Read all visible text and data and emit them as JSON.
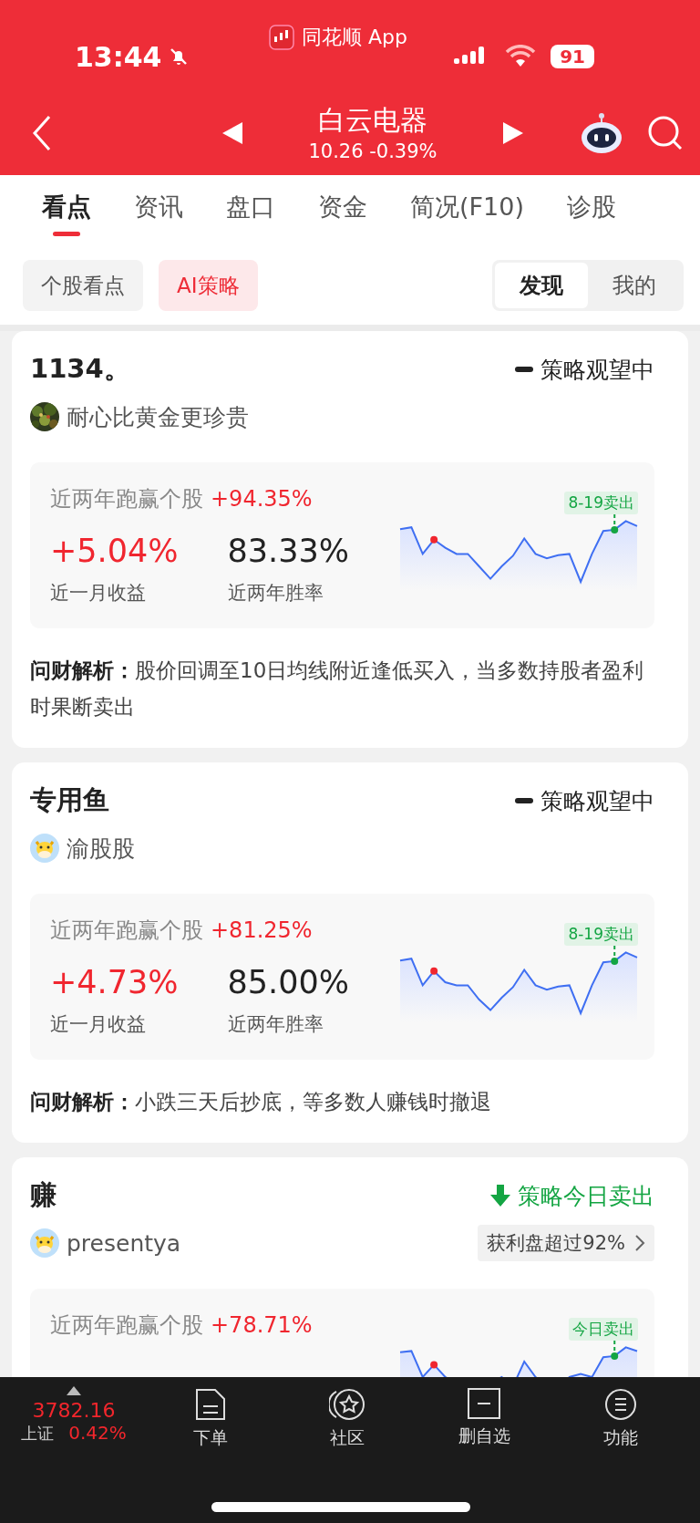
{
  "status_bar": {
    "time": "13:44",
    "app_label": "同花顺 App",
    "battery": "91"
  },
  "header": {
    "title": "白云电器",
    "quote": "10.26 -0.39%"
  },
  "tabs": [
    {
      "label": "看点",
      "selected": true
    },
    {
      "label": "资讯",
      "selected": false
    },
    {
      "label": "盘口",
      "selected": false
    },
    {
      "label": "资金",
      "selected": false
    },
    {
      "label": "简况(F10)",
      "selected": false
    },
    {
      "label": "诊股",
      "selected": false
    }
  ],
  "sub_tabs": [
    {
      "label": "个股看点",
      "selected": false
    },
    {
      "label": "AI策略",
      "selected": true
    }
  ],
  "segments": [
    {
      "label": "发现",
      "selected": true
    },
    {
      "label": "我的",
      "selected": false
    }
  ],
  "cards": [
    {
      "title": "1134。",
      "status": {
        "kind": "watch",
        "label": "策略观望中"
      },
      "author": {
        "name": "耐心比黄金更珍贵"
      },
      "outperform_label": "近两年跑赢个股",
      "outperform_value": "+94.35%",
      "stats": [
        {
          "kind": "return",
          "value": "+5.04%",
          "label": "近一月收益"
        },
        {
          "kind": "rate",
          "value": "83.33%",
          "label": "近两年胜率"
        }
      ],
      "signal_label": "8-19卖出",
      "analysis": "**问财解析：**股价回调至10日均线附近逢低买入，当多数持股者盈利时果断卖出"
    },
    {
      "title": "专用鱼",
      "status": {
        "kind": "watch",
        "label": "策略观望中"
      },
      "author": {
        "name": "渝股股",
        "avatar": {
          "kind": "cartoon"
        }
      },
      "outperform_label": "近两年跑赢个股",
      "outperform_value": "+81.25%",
      "stats": [
        {
          "kind": "return",
          "value": "+4.73%",
          "label": "近一月收益"
        },
        {
          "kind": "rate",
          "value": "85.00%",
          "label": "近两年胜率"
        }
      ],
      "signal_label": "8-19卖出",
      "analysis": "**问财解析：**小跌三天后抄底，等多数人赚钱时撤退"
    },
    {
      "title": "赚",
      "status": {
        "kind": "sell",
        "label": "策略今日卖出"
      },
      "author": {
        "name": "presentya",
        "avatar": {
          "kind": "cartoon"
        }
      },
      "badge": "获利盘超过92%",
      "outperform_label": "近两年跑赢个股",
      "outperform_value": "+78.71%",
      "signal_label": "今日卖出"
    }
  ],
  "bottom_bar": {
    "index": {
      "value": "3782.16",
      "name": "上证",
      "change": "0.42%"
    },
    "items": [
      {
        "kind": "order",
        "label": "下单"
      },
      {
        "kind": "community",
        "label": "社区"
      },
      {
        "kind": "remove",
        "label": "删自选"
      },
      {
        "kind": "menu",
        "label": "功能"
      }
    ]
  }
}
